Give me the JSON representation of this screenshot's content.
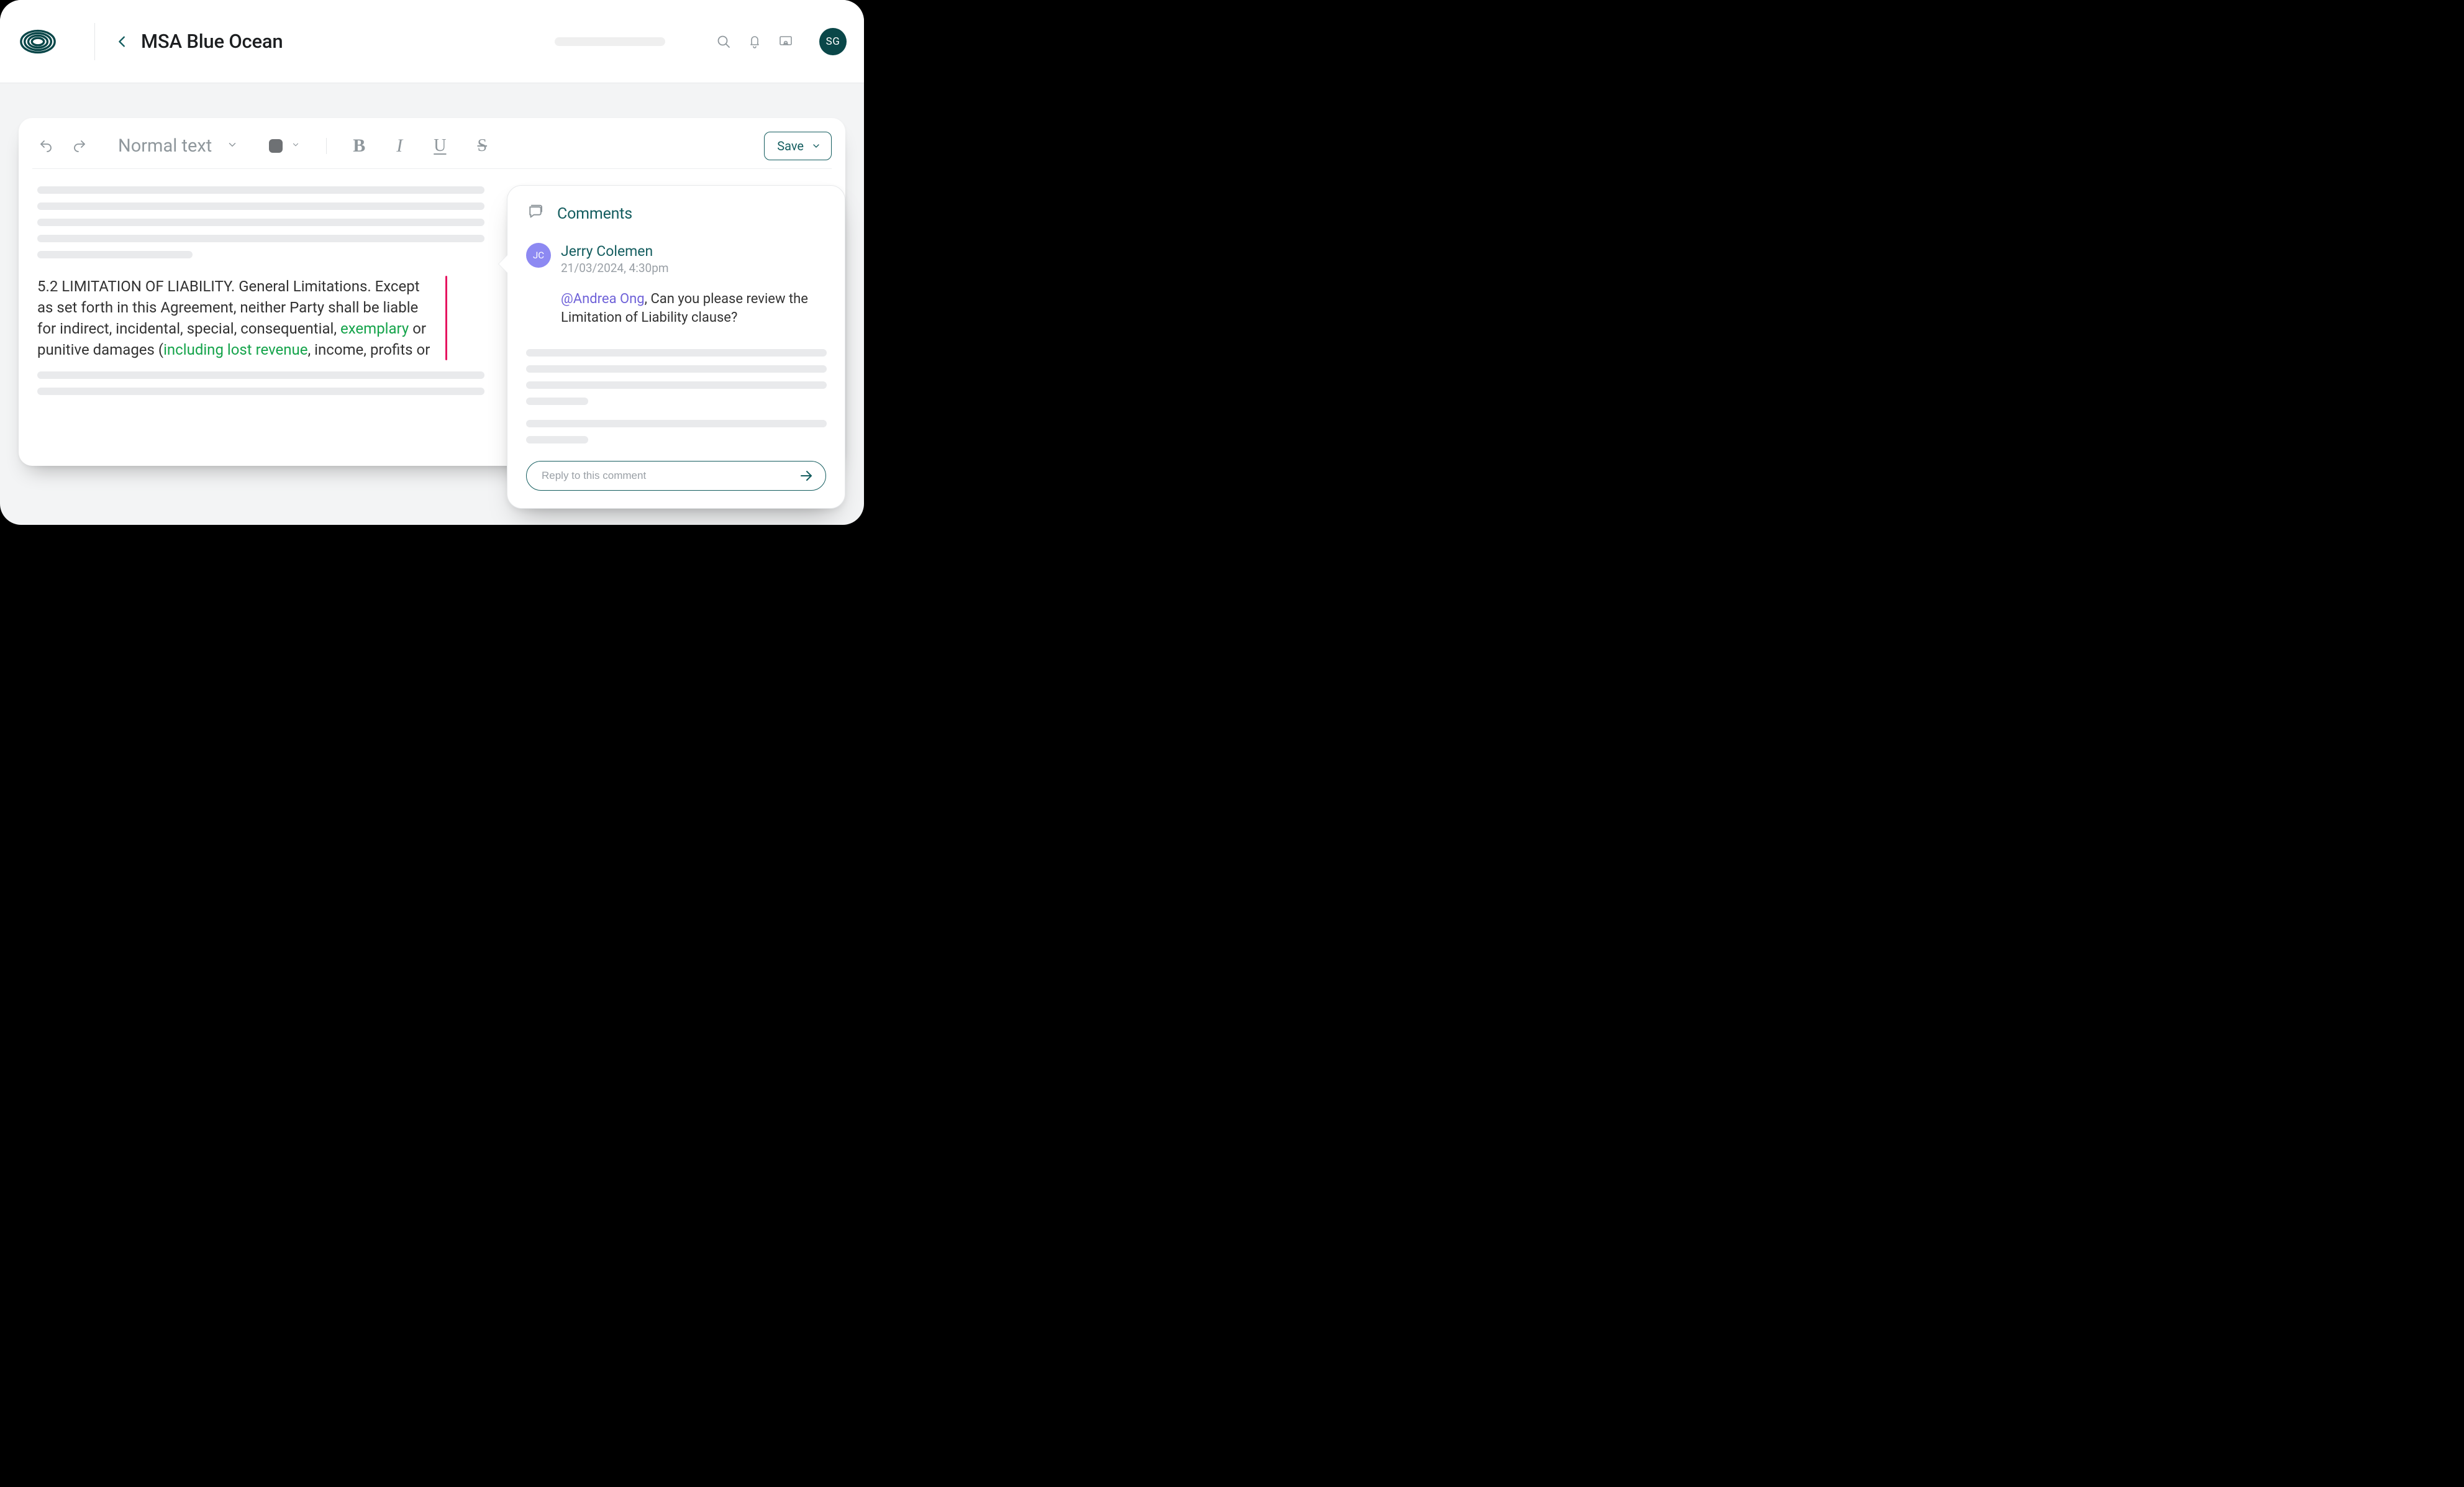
{
  "header": {
    "title": "MSA Blue Ocean",
    "avatar_initials": "SG"
  },
  "toolbar": {
    "text_style_label": "Normal text",
    "bold_glyph": "B",
    "italic_glyph": "I",
    "underline_glyph": "U",
    "strike_glyph": "S",
    "save_label": "Save"
  },
  "document": {
    "highlight": {
      "p_segments": {
        "t1": "5.2 LIMITATION OF LIABILITY. General Limitations. Except as set forth in this Agreement, neither Party shall be liable for indirect, incidental, special, consequential, ",
        "g1": "exemplary",
        "t2": " or punitive damages (",
        "g2": "including lost revenue",
        "t3": ", income, profits or"
      }
    }
  },
  "comments": {
    "panel_title": "Comments",
    "entries": [
      {
        "initials": "JC",
        "author": "Jerry Colemen",
        "meta": "21/03/2024, 4:30pm",
        "mention": "@Andrea Ong",
        "text_tail": ", Can you please review the Limitation of Liability clause?"
      }
    ],
    "reply_placeholder": "Reply to this comment"
  }
}
